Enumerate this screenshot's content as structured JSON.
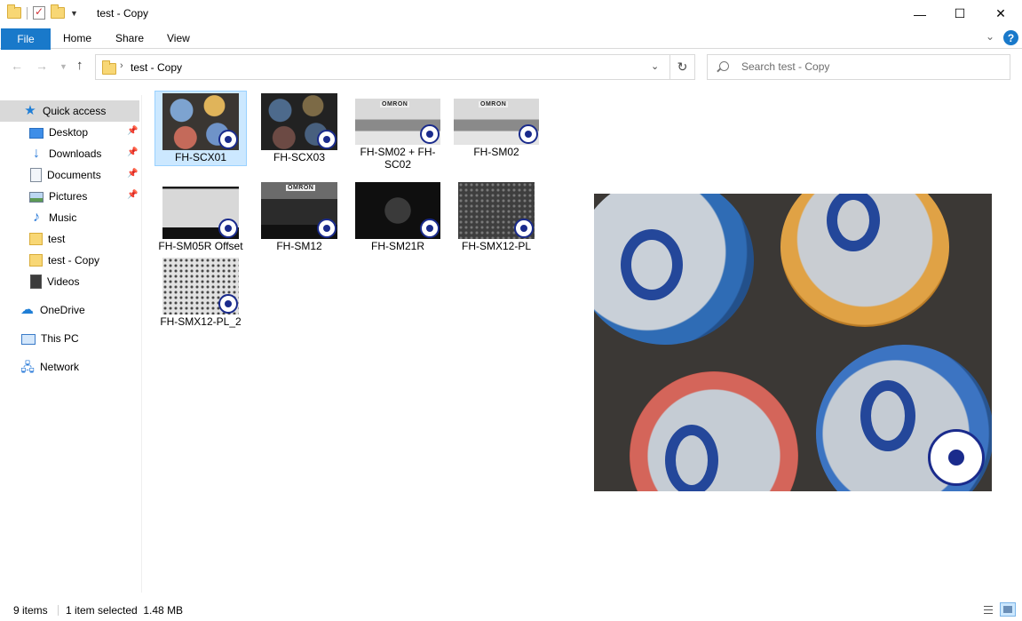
{
  "window": {
    "title": "test - Copy",
    "controls": {
      "minimize": "—",
      "maximize": "☐",
      "close": "✕"
    }
  },
  "ribbon": {
    "tabs": [
      "File",
      "Home",
      "Share",
      "View"
    ],
    "help": "?"
  },
  "address_bar": {
    "path": [
      "test - Copy"
    ],
    "separator": "›"
  },
  "search": {
    "placeholder": "Search test - Copy",
    "value": ""
  },
  "sidebar": {
    "items": [
      {
        "label": "Quick access",
        "icon": "star-icon",
        "selected": true
      },
      {
        "label": "Desktop",
        "icon": "desktop-icon",
        "pinned": true
      },
      {
        "label": "Downloads",
        "icon": "download-icon",
        "pinned": true
      },
      {
        "label": "Documents",
        "icon": "documents-icon",
        "pinned": true
      },
      {
        "label": "Pictures",
        "icon": "pictures-icon",
        "pinned": true
      },
      {
        "label": "Music",
        "icon": "music-icon"
      },
      {
        "label": "test",
        "icon": "folder-icon"
      },
      {
        "label": "test - Copy",
        "icon": "folder-icon"
      },
      {
        "label": "Videos",
        "icon": "videos-icon"
      },
      {
        "label": "OneDrive",
        "icon": "onedrive-icon"
      },
      {
        "label": "This PC",
        "icon": "this-pc-icon"
      },
      {
        "label": "Network",
        "icon": "network-icon"
      }
    ]
  },
  "files": [
    {
      "name": "FH-SCX01",
      "selected": true
    },
    {
      "name": "FH-SCX03"
    },
    {
      "name": "FH-SM02 + FH-SC02"
    },
    {
      "name": "FH-SM02"
    },
    {
      "name": "FH-SM05R Offset"
    },
    {
      "name": "FH-SM12"
    },
    {
      "name": "FH-SM21R"
    },
    {
      "name": "FH-SMX12-PL"
    },
    {
      "name": "FH-SMX12-PL_2"
    }
  ],
  "thumb_text": {
    "omron": "OMRON"
  },
  "status": {
    "item_count": "9 items",
    "selection": "1 item selected  1.48 MB"
  },
  "colors": {
    "accent": "#1979ca",
    "selection": "#cce8ff",
    "selection_border": "#99d1ff"
  }
}
